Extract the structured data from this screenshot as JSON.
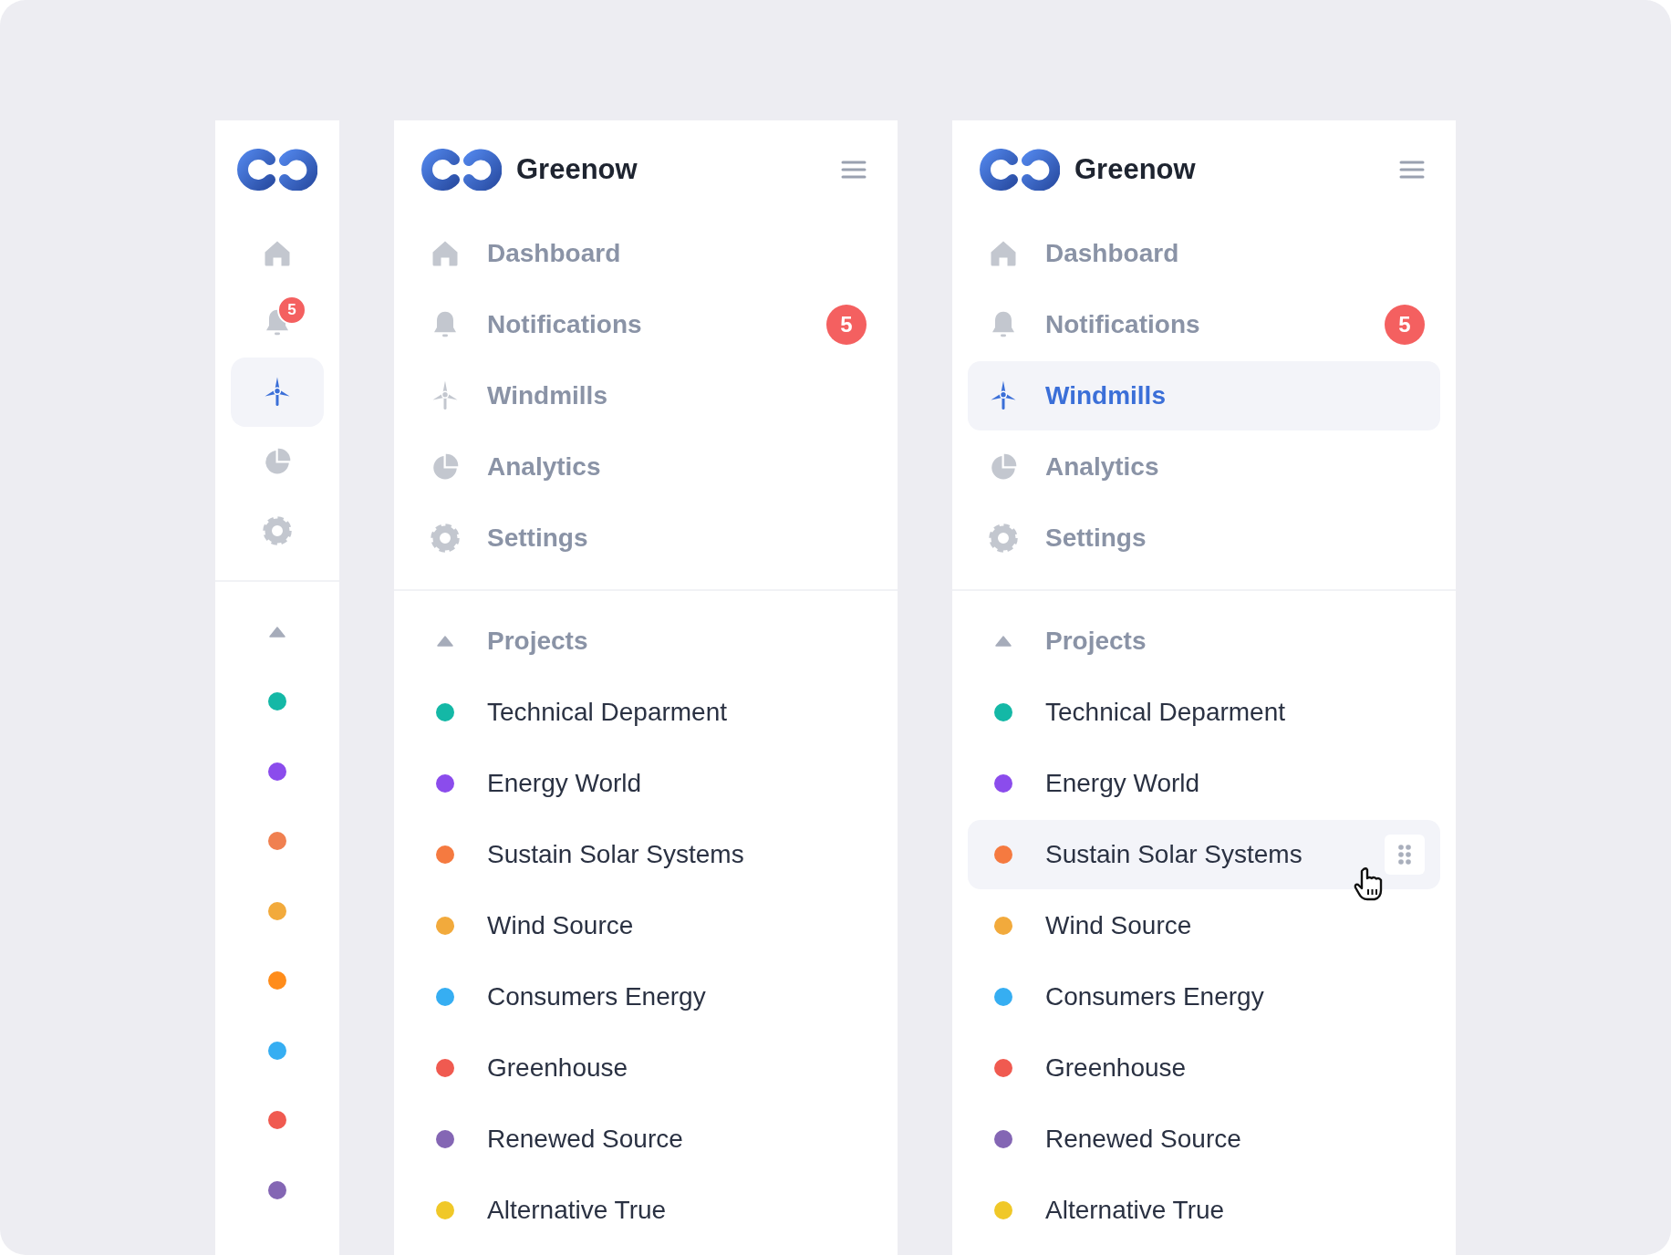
{
  "collapsed_sidebar": {
    "nav": [
      {
        "kind": "home",
        "selected": false
      },
      {
        "kind": "bell",
        "selected": false,
        "badge": "5"
      },
      {
        "kind": "windmill",
        "selected": true
      },
      {
        "kind": "pie",
        "selected": false
      },
      {
        "kind": "gear",
        "selected": false
      }
    ],
    "projects_expanded": true,
    "project_dots": [
      {
        "color": "#14b8a6"
      },
      {
        "color": "#8b4cec"
      },
      {
        "color": "#f08050"
      },
      {
        "color": "#f2aa3c"
      },
      {
        "color": "#ff8c1a"
      },
      {
        "color": "#36aef2"
      },
      {
        "color": "#f05a50"
      },
      {
        "color": "#8466b4"
      }
    ]
  },
  "panels": [
    {
      "title": "Greenow",
      "nav": [
        {
          "kind": "home",
          "label": "Dashboard",
          "selected": false
        },
        {
          "kind": "bell",
          "label": "Notifications",
          "selected": false,
          "badge": "5"
        },
        {
          "kind": "windmill",
          "label": "Windmills",
          "selected": false
        },
        {
          "kind": "pie",
          "label": "Analytics",
          "selected": false
        },
        {
          "kind": "gear",
          "label": "Settings",
          "selected": false
        }
      ],
      "projects_heading": "Projects",
      "projects_expanded": true,
      "projects": [
        {
          "name": "Technical Deparment",
          "color": "#14b8a6",
          "hovered": false
        },
        {
          "name": "Energy World",
          "color": "#8b4cec",
          "hovered": false
        },
        {
          "name": "Sustain Solar Systems",
          "color": "#f57a40",
          "hovered": false
        },
        {
          "name": "Wind Source",
          "color": "#f2aa3c",
          "hovered": false
        },
        {
          "name": "Consumers Energy",
          "color": "#36aef2",
          "hovered": false
        },
        {
          "name": "Greenhouse",
          "color": "#f05a50",
          "hovered": false
        },
        {
          "name": "Renewed Source",
          "color": "#8466b4",
          "hovered": false
        },
        {
          "name": "Alternative True",
          "color": "#f0c828",
          "hovered": false
        }
      ]
    },
    {
      "title": "Greenow",
      "nav": [
        {
          "kind": "home",
          "label": "Dashboard",
          "selected": false
        },
        {
          "kind": "bell",
          "label": "Notifications",
          "selected": false,
          "badge": "5"
        },
        {
          "kind": "windmill",
          "label": "Windmills",
          "selected": true
        },
        {
          "kind": "pie",
          "label": "Analytics",
          "selected": false
        },
        {
          "kind": "gear",
          "label": "Settings",
          "selected": false
        }
      ],
      "projects_heading": "Projects",
      "projects_expanded": true,
      "projects": [
        {
          "name": "Technical Deparment",
          "color": "#14b8a6",
          "hovered": false
        },
        {
          "name": "Energy World",
          "color": "#8b4cec",
          "hovered": false
        },
        {
          "name": "Sustain Solar Systems",
          "color": "#f57a40",
          "hovered": true
        },
        {
          "name": "Wind Source",
          "color": "#f2aa3c",
          "hovered": false
        },
        {
          "name": "Consumers Energy",
          "color": "#36aef2",
          "hovered": false
        },
        {
          "name": "Greenhouse",
          "color": "#f05a50",
          "hovered": false
        },
        {
          "name": "Renewed Source",
          "color": "#8466b4",
          "hovered": false
        },
        {
          "name": "Alternative True",
          "color": "#f0c828",
          "hovered": false
        }
      ]
    }
  ]
}
